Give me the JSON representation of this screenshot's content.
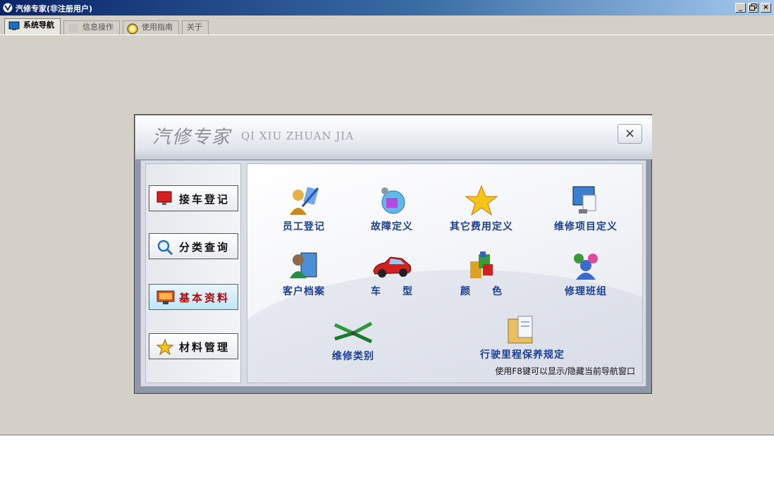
{
  "window": {
    "title": "汽修专家(非注册用户)",
    "controls": [
      "_",
      "🗗",
      "×"
    ]
  },
  "tabs": [
    {
      "label": "系统导航",
      "icon": "monitor-icon",
      "active": true
    },
    {
      "label": "信息操作",
      "icon": "grid-icon",
      "active": false
    },
    {
      "label": "使用指南",
      "icon": "help-icon",
      "active": false
    },
    {
      "label": "关于",
      "icon": "",
      "active": false
    }
  ],
  "dialog": {
    "title": "汽修专家",
    "title_en": "QI XIU ZHUAN JIA",
    "close_label": "×",
    "hint": "使用F8键可以显示/隐藏当前导航窗口"
  },
  "sidebar": {
    "items": [
      {
        "label": "接车登记",
        "icon": "flag-monitor-icon",
        "active": false
      },
      {
        "label": "分类查询",
        "icon": "magnifier-icon",
        "active": false
      },
      {
        "label": "基本资料",
        "icon": "computer-icon",
        "active": true
      },
      {
        "label": "材料管理",
        "icon": "star-icon",
        "active": false
      }
    ]
  },
  "main": {
    "items": [
      {
        "label": "员工登记",
        "icon": "staff-icon"
      },
      {
        "label": "故障定义",
        "icon": "fault-icon"
      },
      {
        "label": "其它费用定义",
        "icon": "star-icon"
      },
      {
        "label": "维修项目定义",
        "icon": "monitor-doc-icon"
      },
      {
        "label": "客户档案",
        "icon": "customer-icon"
      },
      {
        "label": "车　　型",
        "icon": "car-icon"
      },
      {
        "label": "颜　　色",
        "icon": "color-blocks-icon"
      },
      {
        "label": "修理班组",
        "icon": "team-icon"
      },
      {
        "label": "维修类别",
        "icon": "pliers-icon"
      },
      {
        "label": "行驶里程保养规定",
        "icon": "folder-doc-icon"
      }
    ]
  },
  "colors": {
    "titlebar": "#0a246a",
    "face": "#d4d0c8",
    "item_text": "#1c3f94",
    "active_side_text": "#c00000"
  }
}
